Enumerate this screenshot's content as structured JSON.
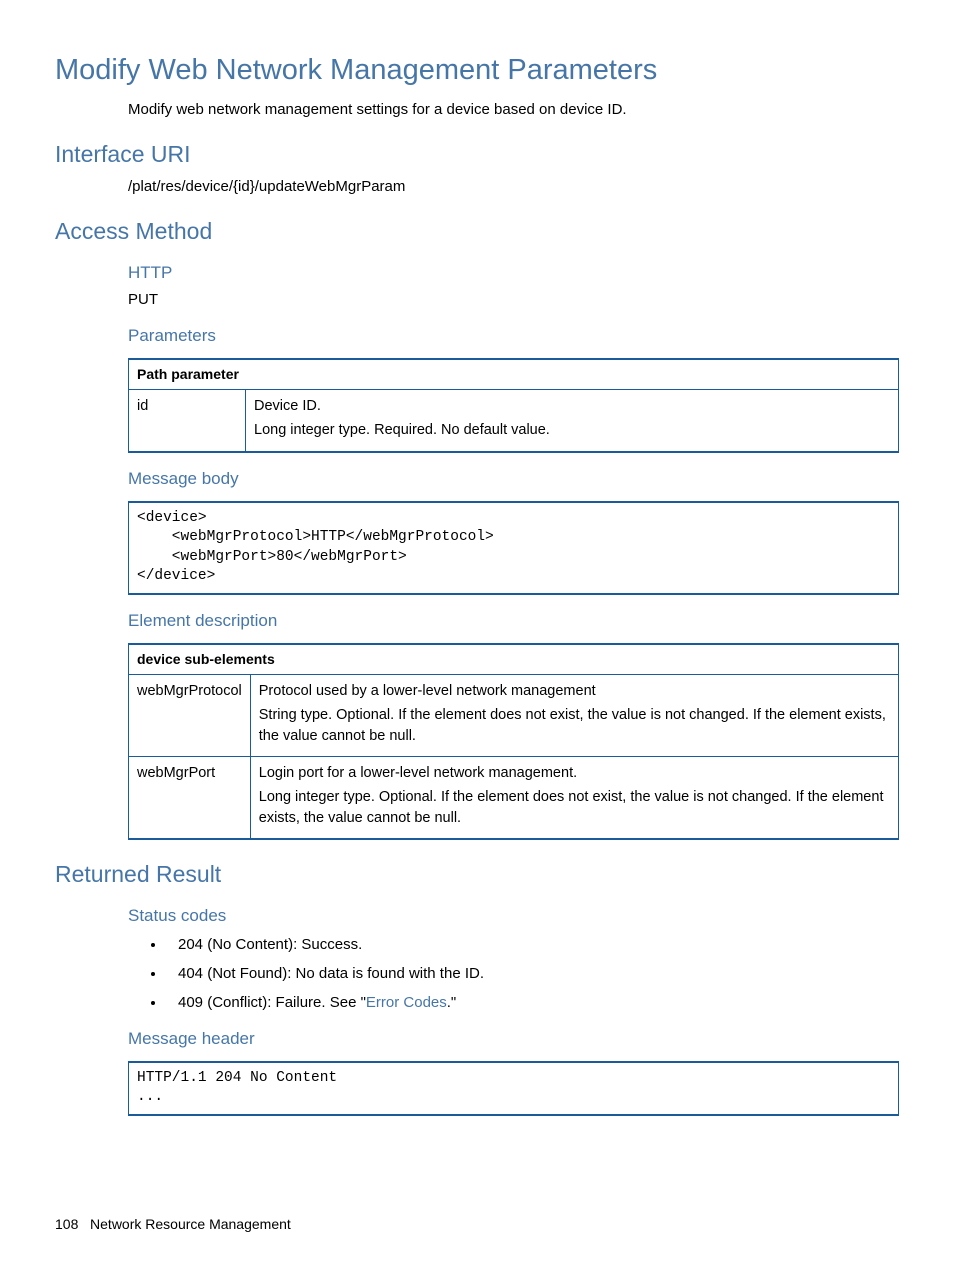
{
  "title": "Modify Web Network Management Parameters",
  "intro": "Modify web network management settings for a device based on device ID.",
  "interface_uri": {
    "heading": "Interface URI",
    "path": "/plat/res/device/{id}/updateWebMgrParam"
  },
  "access_method": {
    "heading": "Access Method",
    "http_heading": "HTTP",
    "http_method": "PUT",
    "parameters_heading": "Parameters",
    "param_table": {
      "header": "Path parameter",
      "rows": [
        {
          "name": "id",
          "desc1": "Device ID.",
          "desc2": "Long integer type. Required. No default value."
        }
      ]
    },
    "message_body": {
      "heading": "Message body",
      "code": "<device>\n    <webMgrProtocol>HTTP</webMgrProtocol>\n    <webMgrPort>80</webMgrPort>\n</device>"
    },
    "element_description": {
      "heading": "Element description",
      "table": {
        "header": "device sub-elements",
        "rows": [
          {
            "name": "webMgrProtocol",
            "desc1": "Protocol used by a lower-level network management",
            "desc2": "String type. Optional. If the element does not exist, the value is not changed. If the element exists, the value cannot be null."
          },
          {
            "name": "webMgrPort",
            "desc1": "Login port for a lower-level network management.",
            "desc2": "Long integer type. Optional. If the element does not exist, the value is not changed. If the element exists, the value cannot be null."
          }
        ]
      }
    }
  },
  "returned_result": {
    "heading": "Returned Result",
    "status_codes": {
      "heading": "Status codes",
      "items": [
        "204 (No Content): Success.",
        "404 (Not Found): No data is found with the ID."
      ],
      "item3_pre": "409 (Conflict): Failure. See \"",
      "item3_link": "Error Codes",
      "item3_post": ".\""
    },
    "message_header": {
      "heading": "Message header",
      "code": "HTTP/1.1 204 No Content\n..."
    }
  },
  "footer": {
    "page": "108",
    "section": "Network Resource Management"
  }
}
